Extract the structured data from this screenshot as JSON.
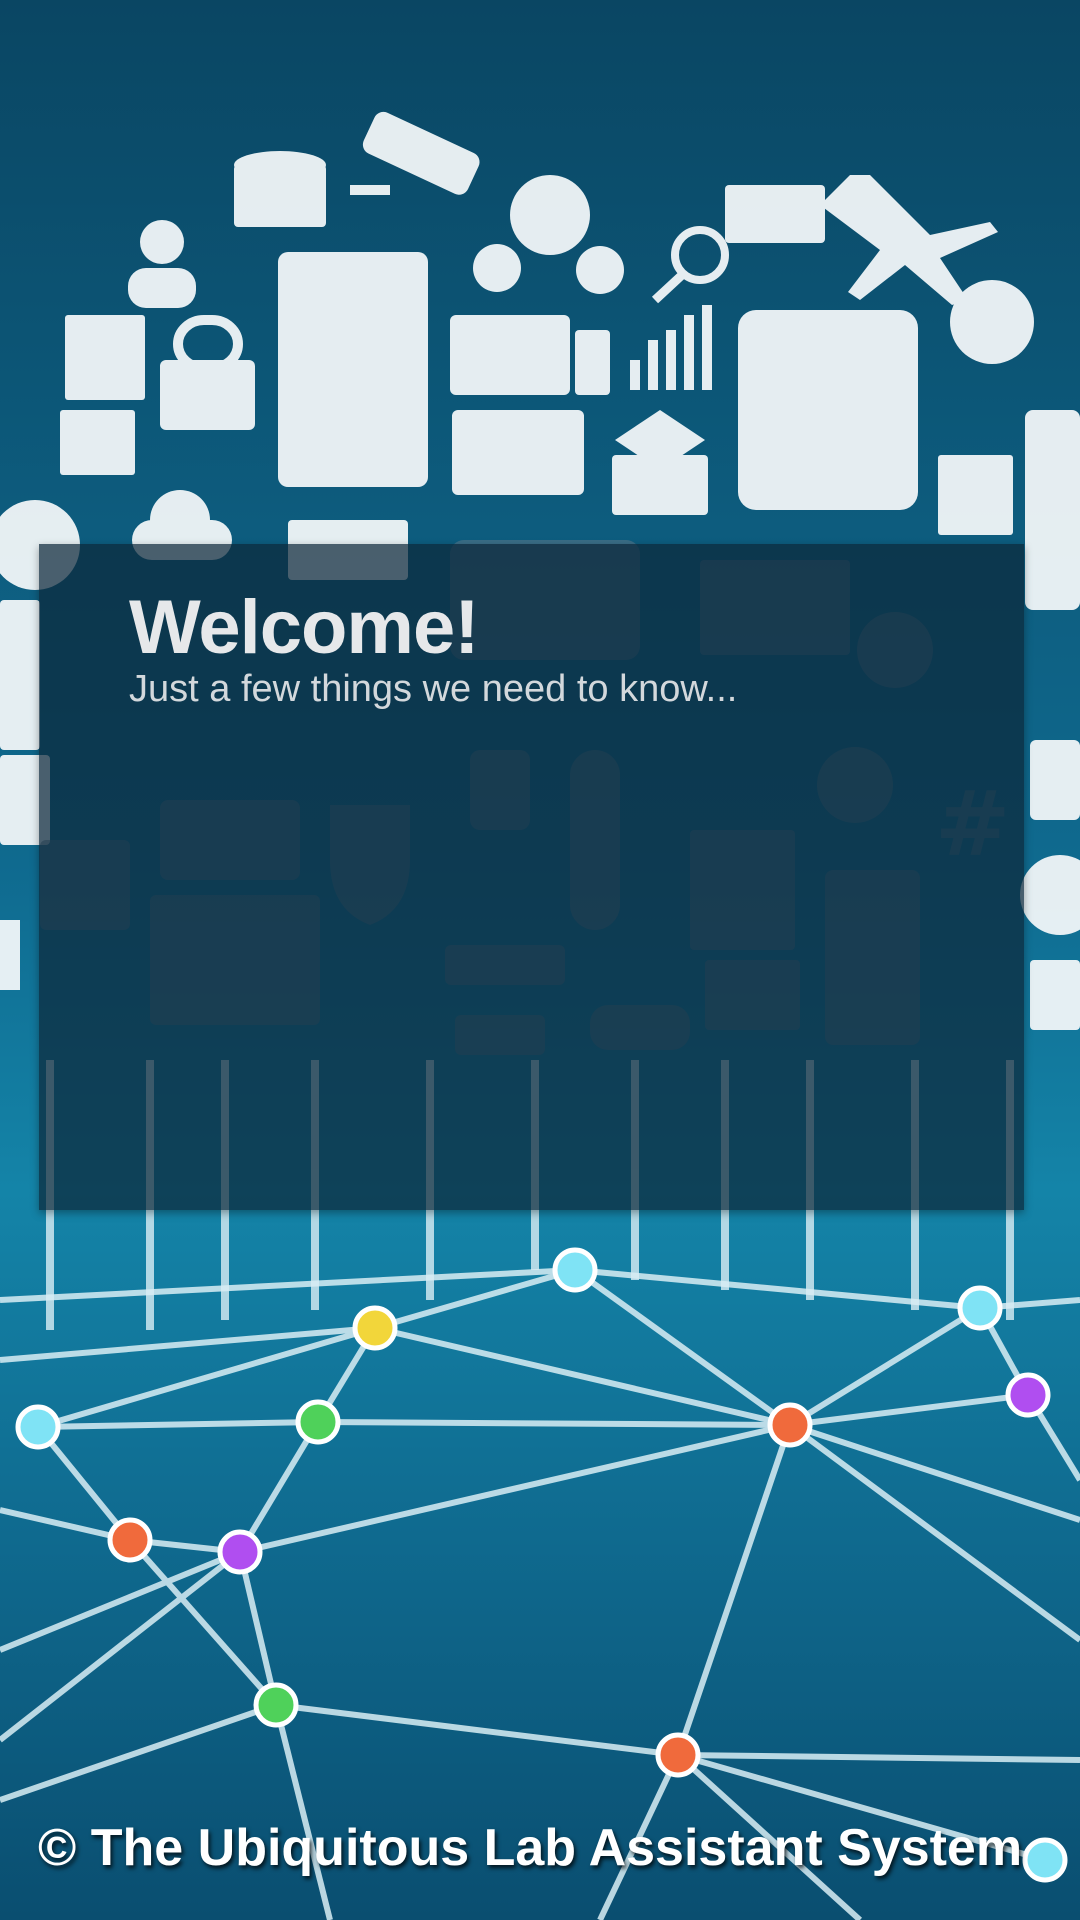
{
  "card": {
    "title": "Welcome!",
    "subtitle": "Just a few things we need to know..."
  },
  "footer": {
    "copyright": "© The Ubiquitous Lab Assistant System"
  },
  "background": {
    "description_icons": [
      "database-icon",
      "security-camera-icon",
      "gears-icon",
      "mail-icon",
      "airplane-icon",
      "user-icon",
      "lock-icon",
      "fridge-icon",
      "devices-icon",
      "bar-chart-icon",
      "mixer-icon",
      "camera-icon",
      "globe-icon",
      "cloud-icon",
      "thermometer-icon",
      "shield-icon",
      "laptop-icon",
      "router-icon",
      "car-icon",
      "coffee-machine-icon",
      "lightbulb-icon",
      "hashtag-icon",
      "watch-icon"
    ],
    "node_colors": [
      "#7fe3f5",
      "#f2d63a",
      "#4fd15a",
      "#f06a3c",
      "#b04ef0"
    ]
  }
}
